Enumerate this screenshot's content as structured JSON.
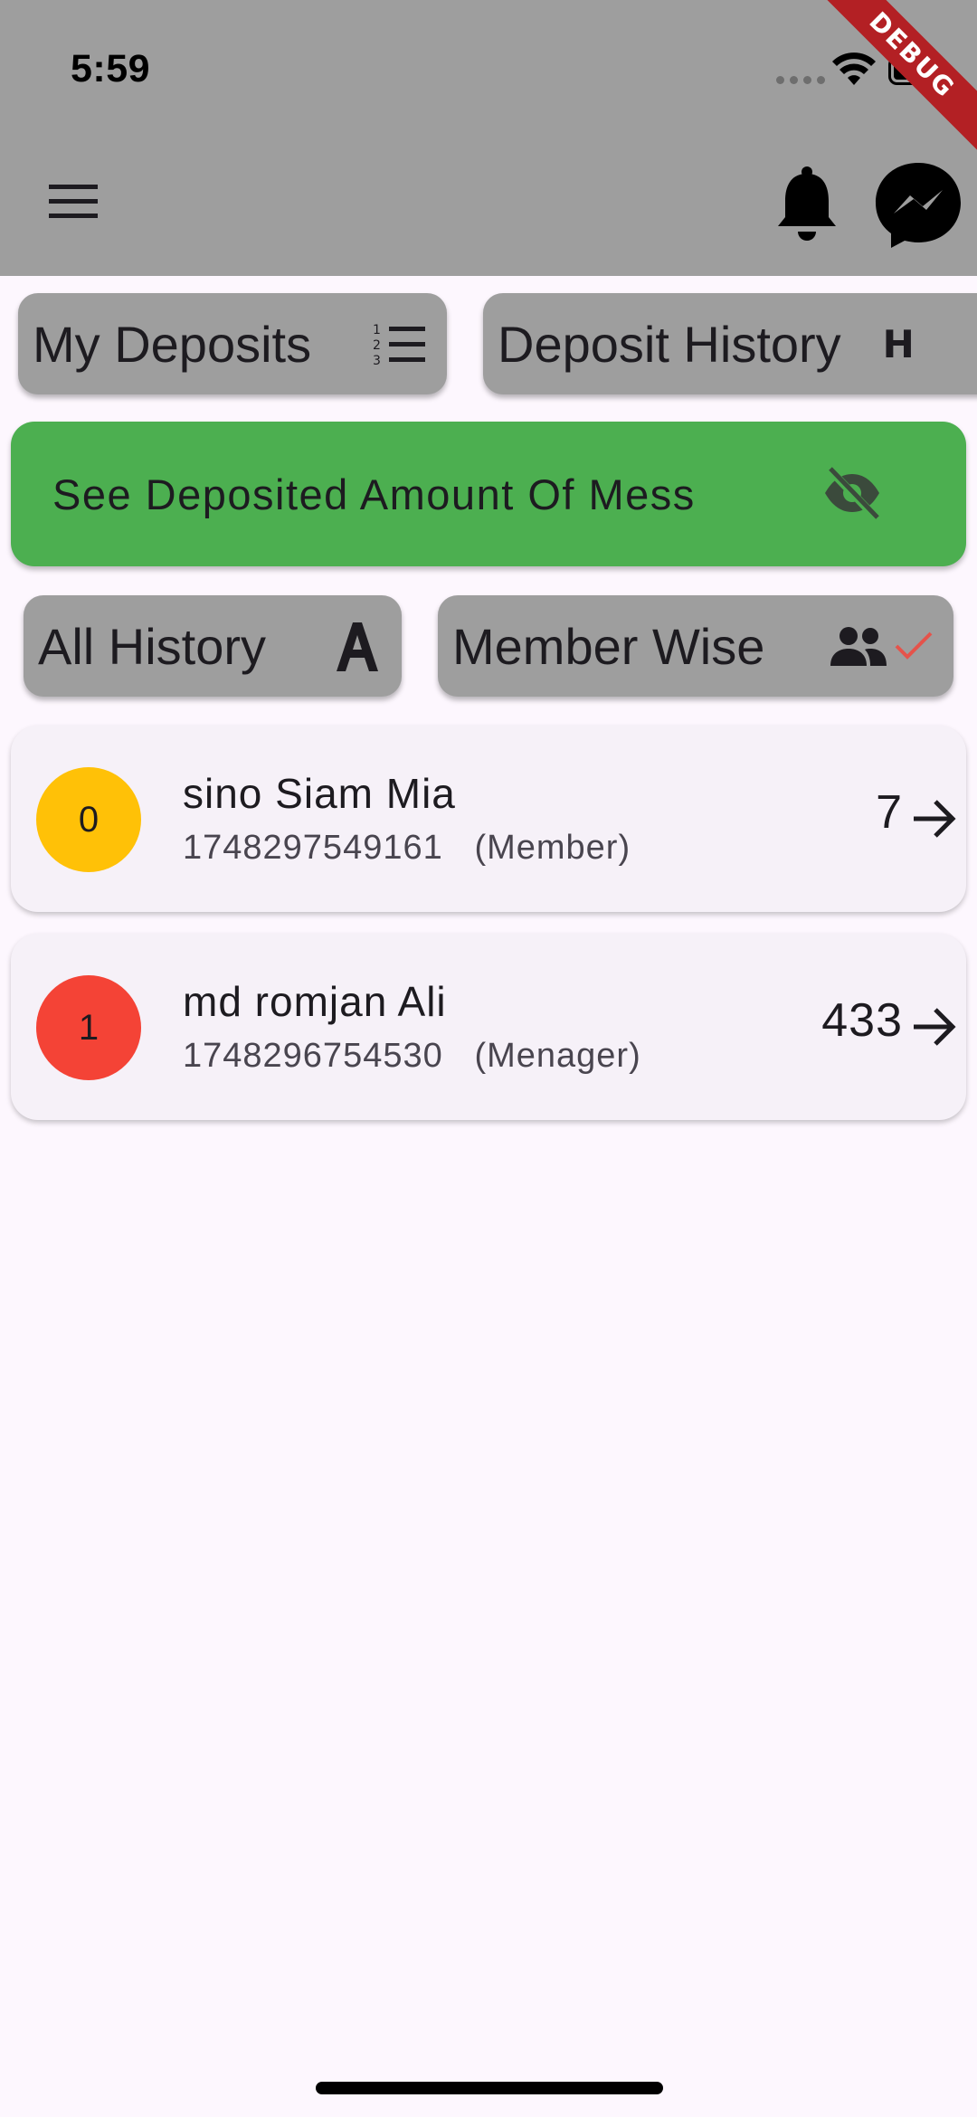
{
  "status_bar": {
    "time": "5:59",
    "wifi_icon": "wifi-icon",
    "battery_icon": "battery-icon"
  },
  "debug_banner": "DEBUG",
  "toolbar": {
    "menu_icon": "hamburger-menu-icon",
    "notification_icon": "bell-icon",
    "messenger_icon": "messenger-icon"
  },
  "tabs": {
    "my_deposits": {
      "label": "My Deposits",
      "icon": "numbered-list-icon"
    },
    "deposit_history": {
      "label": "Deposit History",
      "icon_text": "H"
    }
  },
  "banner": {
    "text": "See Deposited Amount Of Mess",
    "icon": "visibility-off-icon",
    "color": "#4caf50"
  },
  "filters": {
    "all_history": {
      "label": "All History",
      "icon": "letter-a-icon"
    },
    "member_wise": {
      "label": "Member Wise",
      "icon": "people-icon",
      "selected": true,
      "check_color": "#e5534b"
    }
  },
  "members": [
    {
      "index": "0",
      "name": "sino Siam Mia",
      "id": "1748297549161",
      "role": "(Member)",
      "amount": "7",
      "avatar_color": "#ffc107"
    },
    {
      "index": "1",
      "name": "md romjan Ali",
      "id": "1748296754530",
      "role": "(Menager)",
      "amount": "433",
      "avatar_color": "#f44336"
    }
  ],
  "colors": {
    "appbar": "#9e9e9e",
    "background": "#fdf7fe",
    "card": "#f6f1f8"
  }
}
